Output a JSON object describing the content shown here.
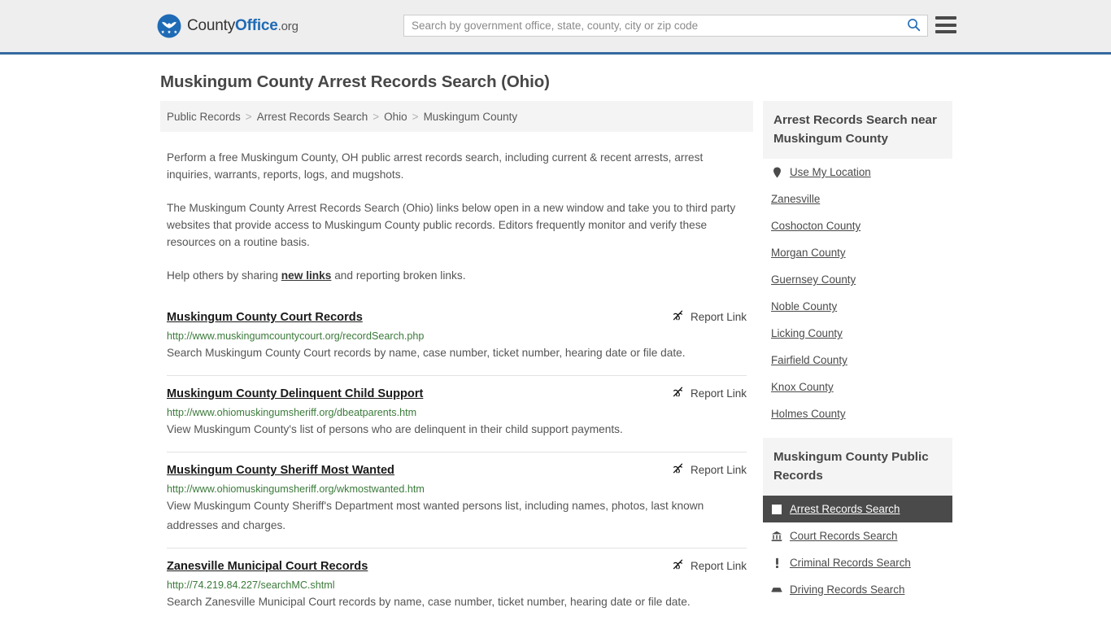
{
  "header": {
    "logo": {
      "icon": "eagle-seal-icon",
      "text_county": "County",
      "text_office": "Office",
      "text_org": ".org"
    },
    "search": {
      "placeholder": "Search by government office, state, county, city or zip code",
      "value": "",
      "icon": "search-icon"
    },
    "menu_icon": "hamburger-menu-icon"
  },
  "page": {
    "title": "Muskingum County Arrest Records Search (Ohio)"
  },
  "breadcrumb": {
    "separator": ">",
    "items": [
      {
        "label": "Public Records"
      },
      {
        "label": "Arrest Records Search"
      },
      {
        "label": "Ohio"
      },
      {
        "label": "Muskingum County"
      }
    ]
  },
  "intro": {
    "paragraph1": "Perform a free Muskingum County, OH public arrest records search, including current & recent arrests, arrest inquiries, warrants, reports, logs, and mugshots.",
    "paragraph2": "The Muskingum County Arrest Records Search (Ohio) links below open in a new window and take you to third party websites that provide access to Muskingum County public records. Editors frequently monitor and verify these resources on a routine basis.",
    "paragraph3_before": "Help others by sharing ",
    "paragraph3_link": "new links",
    "paragraph3_after": " and reporting broken links."
  },
  "report_link": {
    "label": "Report Link",
    "icon": "broken-link-icon"
  },
  "results": [
    {
      "title": "Muskingum County Court Records",
      "url": "http://www.muskingumcountycourt.org/recordSearch.php",
      "description": "Search Muskingum County Court records by name, case number, ticket number, hearing date or file date."
    },
    {
      "title": "Muskingum County Delinquent Child Support",
      "url": "http://www.ohiomuskingumsheriff.org/dbeatparents.htm",
      "description": "View Muskingum County's list of persons who are delinquent in their child support payments."
    },
    {
      "title": "Muskingum County Sheriff Most Wanted",
      "url": "http://www.ohiomuskingumsheriff.org/wkmostwanted.htm",
      "description": "View Muskingum County Sheriff's Department most wanted persons list, including names, photos, last known addresses and charges."
    },
    {
      "title": "Zanesville Municipal Court Records",
      "url": "http://74.219.84.227/searchMC.shtml",
      "description": "Search Zanesville Municipal Court records by name, case number, ticket number, hearing date or file date."
    }
  ],
  "sidebar": {
    "near_panel": {
      "title": "Arrest Records Search near Muskingum County",
      "items": [
        {
          "label": "Use My Location",
          "icon": "map-pin-icon"
        },
        {
          "label": "Zanesville",
          "icon": ""
        },
        {
          "label": "Coshocton County",
          "icon": ""
        },
        {
          "label": "Morgan County",
          "icon": ""
        },
        {
          "label": "Guernsey County",
          "icon": ""
        },
        {
          "label": "Noble County",
          "icon": ""
        },
        {
          "label": "Licking County",
          "icon": ""
        },
        {
          "label": "Fairfield County",
          "icon": ""
        },
        {
          "label": "Knox County",
          "icon": ""
        },
        {
          "label": "Holmes County",
          "icon": ""
        }
      ]
    },
    "records_panel": {
      "title": "Muskingum County Public Records",
      "items": [
        {
          "label": "Arrest Records Search",
          "icon": "white-square-icon",
          "active": true
        },
        {
          "label": "Court Records Search",
          "icon": "courthouse-icon",
          "active": false
        },
        {
          "label": "Criminal Records Search",
          "icon": "exclamation-icon",
          "active": false
        },
        {
          "label": "Driving Records Search",
          "icon": "car-icon",
          "active": false
        }
      ]
    }
  },
  "colors": {
    "header_bg": "#eeeeee",
    "header_border": "#34699e",
    "accent_blue": "#1f6ab5",
    "url_green": "#3b7a3b",
    "panel_bg": "#f4f4f4",
    "active_bg": "#4a4a4a"
  }
}
